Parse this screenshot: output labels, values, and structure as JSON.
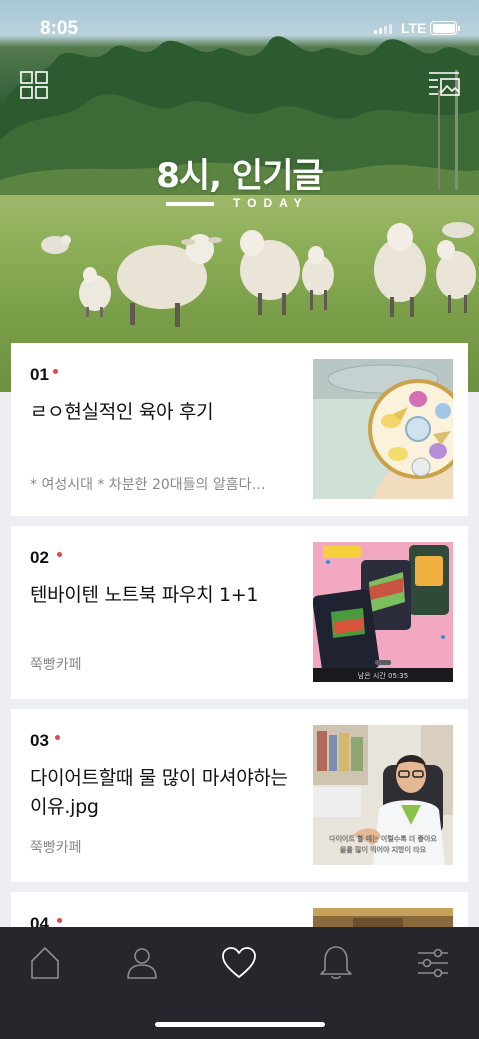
{
  "status": {
    "time": "8:05",
    "network": "LTE"
  },
  "header": {
    "grid_icon": "grid-icon",
    "menu_icon": "list-menu-icon",
    "title": "8시, 인기글",
    "subtitle": "TODAY"
  },
  "articles": [
    {
      "rank": "01",
      "title": "ㄹㅇ현실적인 육아 후기",
      "source": "* 여성시대 *  차분한 20대들의 알흠다…"
    },
    {
      "rank": "02",
      "title": "텐바이텐 노트북 파우치 1+1",
      "source": "쭉빵카페",
      "thumb_caption": "남은 시간 05:35"
    },
    {
      "rank": "03",
      "title": "다이어트할때 물 많이 마셔야하는 이유.jpg",
      "source": "쭉빵카페",
      "thumb_caption_line1": "다이어트 할 때는 이럴수록 더 좋아요",
      "thumb_caption_line2": "물을 많이 먹어야 지방이 타요"
    },
    {
      "rank": "04"
    }
  ],
  "tabbar": {
    "items": [
      {
        "name": "home",
        "icon": "home-icon"
      },
      {
        "name": "profile",
        "icon": "person-icon"
      },
      {
        "name": "favorites",
        "icon": "heart-icon",
        "active": true
      },
      {
        "name": "notifications",
        "icon": "bell-icon"
      },
      {
        "name": "settings",
        "icon": "sliders-icon"
      }
    ]
  },
  "colors": {
    "accent_dot": "#e8444b",
    "tabbar_bg": "#25272c",
    "page_bg": "#eceef1"
  }
}
